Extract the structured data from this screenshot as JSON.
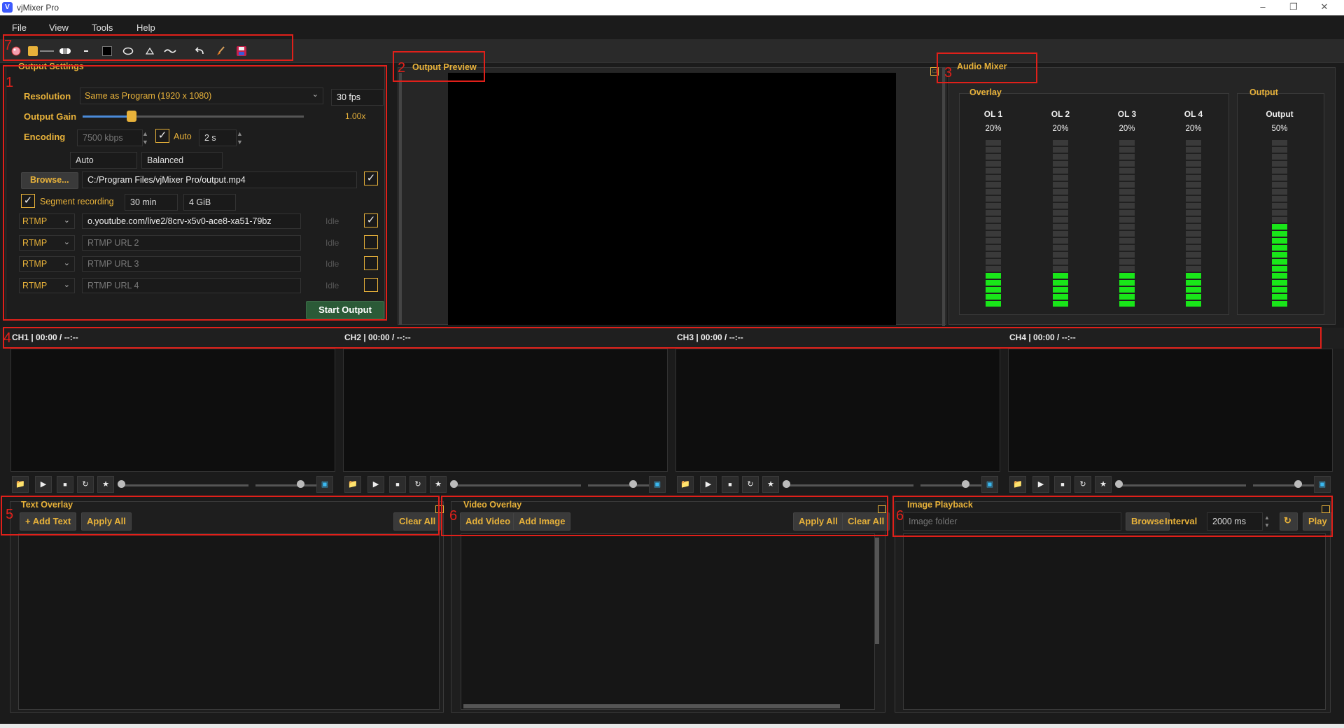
{
  "app": {
    "title": "vjMixer Pro"
  },
  "menu": [
    "File",
    "View",
    "Tools",
    "Help"
  ],
  "annotations": {
    "n1": "1",
    "n2": "2",
    "n3": "3",
    "n4": "4",
    "n5": "5",
    "n6a": "6",
    "n6b": "6",
    "n7": "7"
  },
  "output_settings": {
    "title": "Output Settings",
    "resolution_label": "Resolution",
    "resolution_value": "Same as Program (1920 x 1080)",
    "fps": "30 fps",
    "gain_label": "Output Gain",
    "gain_value": "1.00x",
    "gain_fraction": 0.22,
    "encoding_label": "Encoding",
    "bitrate": "7500 kbps",
    "auto_label": "Auto",
    "auto_checked": true,
    "keyframe": "2 s",
    "encoder": "Auto",
    "preset": "Balanced",
    "browse_label": "Browse...",
    "path": "C:/Program Files/vjMixer Pro/output.mp4",
    "path_checked": true,
    "segment_label": "Segment recording",
    "segment_checked": true,
    "segment_time": "30 min",
    "segment_size": "4 GiB",
    "rtmp": [
      {
        "proto": "RTMP",
        "url": "o.youtube.com/live2/8crv-x5v0-ace8-xa51-79bz",
        "placeholder": "",
        "status": "Idle",
        "checked": true
      },
      {
        "proto": "RTMP",
        "url": "",
        "placeholder": "RTMP URL 2",
        "status": "Idle",
        "checked": false
      },
      {
        "proto": "RTMP",
        "url": "",
        "placeholder": "RTMP URL 3",
        "status": "Idle",
        "checked": false
      },
      {
        "proto": "RTMP",
        "url": "",
        "placeholder": "RTMP URL 4",
        "status": "Idle",
        "checked": false
      }
    ],
    "start_label": "Start Output"
  },
  "preview": {
    "title": "Output Preview"
  },
  "audio": {
    "title": "Audio Mixer",
    "overlay_label": "Overlay",
    "output_label": "Output",
    "channels": [
      {
        "name": "OL 1",
        "pct": "20%",
        "level": 0.2
      },
      {
        "name": "OL 2",
        "pct": "20%",
        "level": 0.2
      },
      {
        "name": "OL 3",
        "pct": "20%",
        "level": 0.2
      },
      {
        "name": "OL 4",
        "pct": "20%",
        "level": 0.2
      }
    ],
    "output": {
      "name": "Output",
      "pct": "50%",
      "level": 0.5
    }
  },
  "channels": [
    {
      "label": "CH1 | 00:00 / --:--",
      "position": 0.0,
      "volume": 0.7
    },
    {
      "label": "CH2 | 00:00 / --:--",
      "position": 0.0,
      "volume": 0.7
    },
    {
      "label": "CH3 | 00:00 / --:--",
      "position": 0.0,
      "volume": 0.7
    },
    {
      "label": "CH4 | 00:00 / --:--",
      "position": 0.0,
      "volume": 0.7
    }
  ],
  "text_overlay": {
    "title": "Text Overlay",
    "add": "+ Add Text",
    "apply": "Apply All",
    "clear": "Clear All"
  },
  "video_overlay": {
    "title": "Video Overlay",
    "add_video": "Add Video",
    "add_image": "Add Image",
    "apply": "Apply All",
    "clear": "Clear All"
  },
  "image_playback": {
    "title": "Image Playback",
    "folder_placeholder": "Image folder",
    "browse": "Browse",
    "interval_label": "Interval",
    "interval": "2000 ms",
    "play": "Play"
  },
  "colors": {
    "accent": "#e8b23a",
    "meter_on": "#19e619",
    "meter_off": "#3a3a3a",
    "annotation": "#e0201a"
  }
}
